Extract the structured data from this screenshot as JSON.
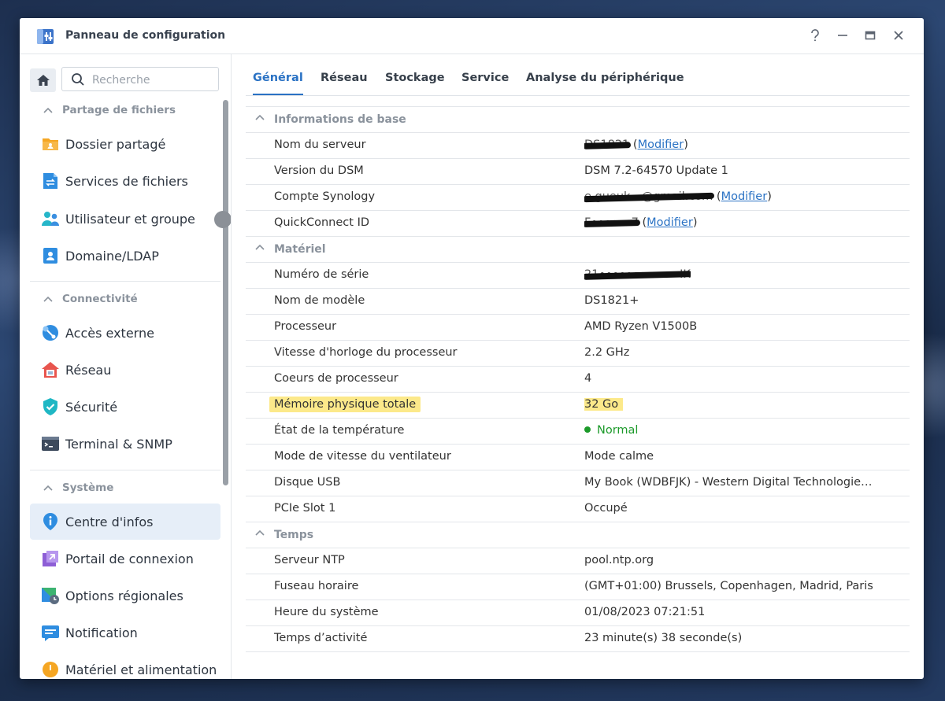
{
  "window": {
    "title": "Panneau de configuration"
  },
  "colors": {
    "accent": "#2a72c4",
    "status_ok": "#1c9a2a",
    "highlight": "#fce98a"
  },
  "sidebar": {
    "search_placeholder": "Recherche",
    "groups": [
      {
        "title": "Partage de fichiers",
        "items": [
          {
            "label": "Dossier partagé",
            "icon": "shared-folder-icon"
          },
          {
            "label": "Services de fichiers",
            "icon": "file-services-icon"
          },
          {
            "label": "Utilisateur et groupe",
            "icon": "user-group-icon"
          },
          {
            "label": "Domaine/LDAP",
            "icon": "domain-ldap-icon"
          }
        ]
      },
      {
        "title": "Connectivité",
        "items": [
          {
            "label": "Accès externe",
            "icon": "external-access-icon"
          },
          {
            "label": "Réseau",
            "icon": "network-house-icon"
          },
          {
            "label": "Sécurité",
            "icon": "security-shield-icon"
          },
          {
            "label": "Terminal & SNMP",
            "icon": "terminal-icon"
          }
        ]
      },
      {
        "title": "Système",
        "items": [
          {
            "label": "Centre d'infos",
            "icon": "info-center-icon",
            "active": true
          },
          {
            "label": "Portail de connexion",
            "icon": "login-portal-icon"
          },
          {
            "label": "Options régionales",
            "icon": "regional-options-icon"
          },
          {
            "label": "Notification",
            "icon": "notification-icon"
          },
          {
            "label": "Matériel et alimentation",
            "icon": "hardware-power-icon"
          }
        ]
      }
    ]
  },
  "tabs": [
    "Général",
    "Réseau",
    "Stockage",
    "Service",
    "Analyse du périphérique"
  ],
  "modify_label": "Modifier",
  "sections": {
    "base": {
      "title": "Informations de base",
      "server_name": {
        "label": "Nom du serveur",
        "value": "DS1821"
      },
      "dsm_version": {
        "label": "Version du DSM",
        "value": "DSM 7.2-64570 Update 1"
      },
      "synology_account": {
        "label": "Compte Synology",
        "value": "e.gueuk…@gmail.com"
      },
      "quickconnect": {
        "label": "QuickConnect ID",
        "value": "F••••••7"
      }
    },
    "hardware": {
      "title": "Matériel",
      "serial": {
        "label": "Numéro de série",
        "value": "21••••••••••••IK"
      },
      "model": {
        "label": "Nom de modèle",
        "value": "DS1821+"
      },
      "cpu": {
        "label": "Processeur",
        "value": "AMD Ryzen V1500B"
      },
      "clock": {
        "label": "Vitesse d'horloge du processeur",
        "value": "2.2 GHz"
      },
      "cores": {
        "label": "Coeurs de processeur",
        "value": "4"
      },
      "memory": {
        "label": "Mémoire physique totale",
        "value": "32 Go"
      },
      "temperature": {
        "label": "État de la température",
        "value": "Normal"
      },
      "fan": {
        "label": "Mode de vitesse du ventilateur",
        "value": "Mode calme"
      },
      "usb": {
        "label": "Disque USB",
        "value": "My Book (WDBFJK) - Western Digital Technologie…"
      },
      "pcie": {
        "label": "PCIe Slot 1",
        "value": "Occupé"
      }
    },
    "time": {
      "title": "Temps",
      "ntp": {
        "label": "Serveur NTP",
        "value": "pool.ntp.org"
      },
      "timezone": {
        "label": "Fuseau horaire",
        "value": "(GMT+01:00) Brussels, Copenhagen, Madrid, Paris"
      },
      "system_time": {
        "label": "Heure du système",
        "value": "01/08/2023 07:21:51"
      },
      "uptime": {
        "label": "Temps d’activité",
        "value": "23 minute(s) 38 seconde(s)"
      }
    }
  }
}
